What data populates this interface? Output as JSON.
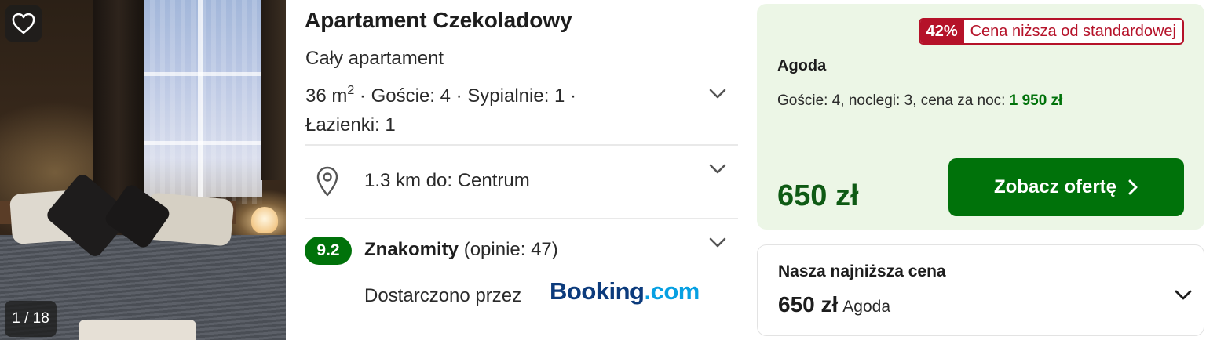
{
  "photo": {
    "counter": "1 / 18",
    "favorite_icon": "heart-outline-icon"
  },
  "listing": {
    "title": "Apartament Czekoladowy",
    "type": "Cały apartament",
    "area_value": "36 m",
    "area_exp": "2",
    "details_rest": " · Goście: 4 · Sypialnie: 1 · Łazienki: 1",
    "distance": "1.3 km do: Centrum",
    "score": "9.2",
    "rating_word": "Znakomity",
    "reviews": " (opinie: 47)",
    "provided_by": "Dostarczono przez",
    "provider_logo_part1": "Booking",
    "provider_logo_part2": ".com"
  },
  "offer": {
    "discount_pct": "42%",
    "discount_text": "Cena niższa od standardowej",
    "provider": "Agoda",
    "stay_info": "Goście: 4, noclegi: 3, cena za noc: ",
    "night_price": "1 950 zł",
    "total_price": "650 zł",
    "cta_label": "Zobacz ofertę"
  },
  "lowest": {
    "title": "Nasza najniższa cena",
    "price": "650 zł",
    "provider": "Agoda"
  },
  "colors": {
    "accent_green": "#00720a",
    "offer_bg": "#ecf6e6",
    "discount_red": "#b51229",
    "booking_dark": "#0c3b7c",
    "booking_light": "#07a0e2"
  }
}
